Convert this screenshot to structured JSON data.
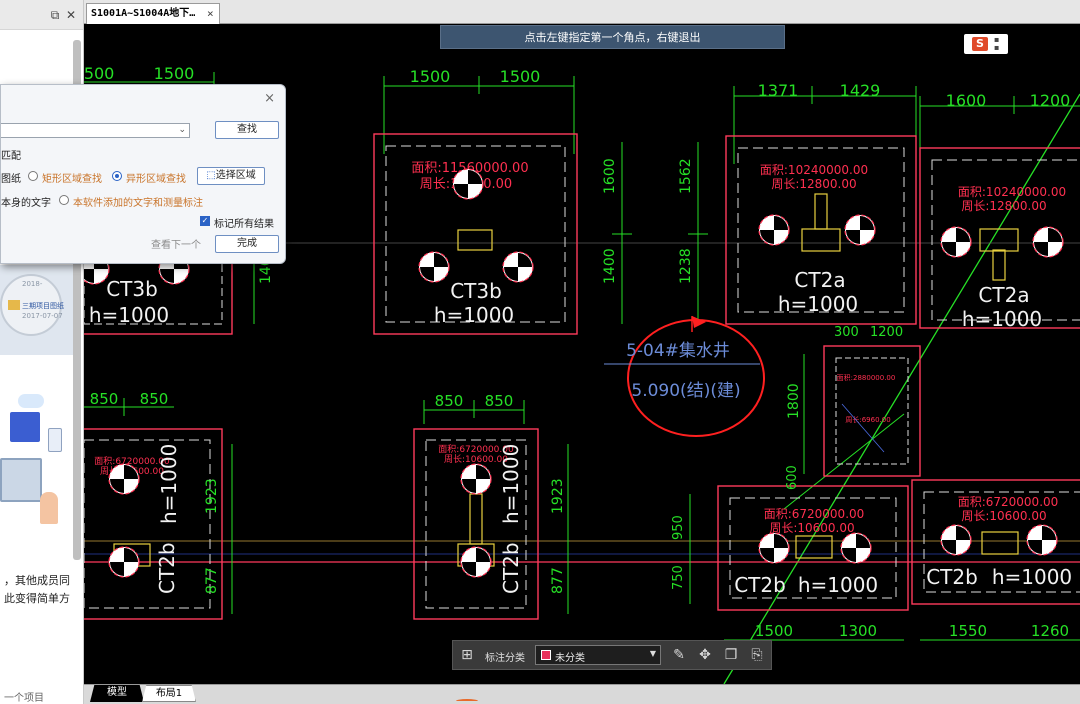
{
  "colors": {
    "canvas_bg": "#000000",
    "frame_red": "#ff3b5c",
    "dim_green": "#26e026",
    "text_white": "#f2f2f2",
    "text_red": "#ff3050",
    "annotation_blue": "#6c8cd8",
    "cloud_red": "#ff2020",
    "prompt_bg": "#3d5570"
  },
  "left_panel": {
    "feature_text_1": "，其他成员同",
    "feature_text_2": "此变得简单方",
    "bottom_text": "一个项目",
    "thumb_date_1": "2018-",
    "thumb_date_2": "2017-07-07",
    "thumb_name": "三期项目图纸",
    "icons": [
      "restore-icon",
      "close-icon"
    ]
  },
  "document_tab": {
    "title": "S1001A~S1004A地下…",
    "close": "×"
  },
  "prompt": "点击左键指定第一个角点，右键退出",
  "dialog": {
    "close": "×",
    "find_button": "查找",
    "match_label": "匹配",
    "drawing_label": "图纸",
    "rect_search": "矩形区域查找",
    "irregular_search": "异形区域查找",
    "select_area_button": "选择区域",
    "own_text": "本身的文字",
    "added_text": "本软件添加的文字和测量标注",
    "mark_all": "标记所有结果",
    "view_next": "查看下一个",
    "done_button": "完成"
  },
  "floating_toolbar": {
    "label": "标注分类",
    "selected": "未分类",
    "swatch_color": "#e8305a",
    "icons": [
      "grid-icon",
      "edit-icon",
      "move-icon",
      "copy-icon",
      "paste-icon"
    ]
  },
  "model_tabs": {
    "model": "模型",
    "layout": "布局1"
  },
  "cad": {
    "dims_top": [
      "1500",
      "1500",
      "1500",
      "1371",
      "1429",
      "1600",
      "1200"
    ],
    "dims_side": [
      "1600",
      "1400",
      "1562",
      "1238",
      "1400",
      "1800",
      "1923",
      "877",
      "950",
      "750",
      "600"
    ],
    "dims_mid": [
      "850",
      "850",
      "850",
      "850",
      "300",
      "1200"
    ],
    "dims_bottom": [
      "1500",
      "1300",
      "1550",
      "1260"
    ],
    "ct3b_area": "面积:11560000.00",
    "ct3b_perim": "周长:13600.00",
    "ct2a_area": "面积:10240000.00",
    "ct2a_perim": "周长:12800.00",
    "ct2b_area": "面积:6720000.00",
    "ct2b_perim": "周长:10600.00",
    "small_area": "面积:2880000.00",
    "small_perim": "周长:6960.00",
    "label_ct3b": "CT3b",
    "label_ct2a": "CT2a",
    "label_ct2b": "CT2b",
    "label_h": "h=1000",
    "cloud_line1": "5-04#集水井",
    "cloud_line2": "5.090(结)(建)"
  }
}
